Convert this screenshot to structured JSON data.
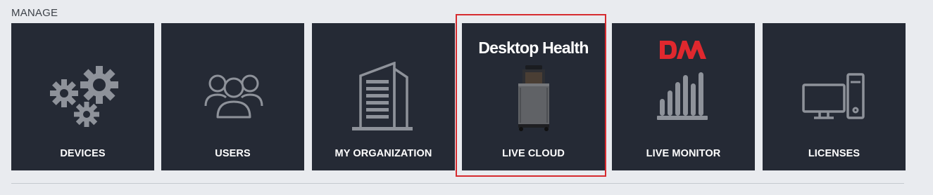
{
  "section": {
    "title": "MANAGE"
  },
  "tiles": [
    {
      "label": "DEVICES",
      "icon": "gears-icon"
    },
    {
      "label": "USERS",
      "icon": "users-icon"
    },
    {
      "label": "MY ORGANIZATION",
      "icon": "building-icon"
    },
    {
      "label": "LIVE CLOUD",
      "icon": "printer-image",
      "brand": "Desktop Health",
      "selected": true
    },
    {
      "label": "LIVE MONITOR",
      "icon": "bar-chart-icon",
      "brand_logo": "DM"
    },
    {
      "label": "LICENSES",
      "icon": "computer-icon"
    }
  ],
  "colors": {
    "page_bg": "#e9ebef",
    "tile_bg": "#252a35",
    "icon_gray": "#8e929a",
    "selection_border": "#d62b2f",
    "brand_red": "#e0282e"
  }
}
